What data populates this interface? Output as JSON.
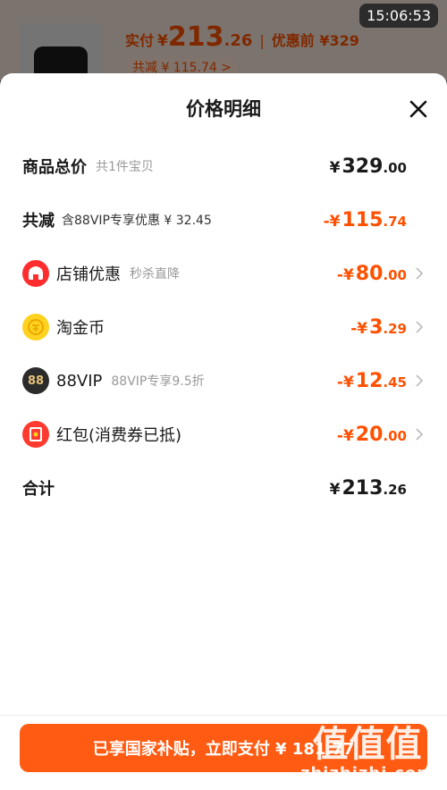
{
  "status": {
    "time": "15:06:53"
  },
  "background": {
    "pay_label": "实付",
    "pay_yen": "¥",
    "pay_int": "213",
    "pay_dec": ".26",
    "separator": "|",
    "orig_label": "优惠前 ¥329",
    "saved": "共减 ¥ 115.74 >"
  },
  "sheet": {
    "title": "价格明细",
    "rows": [
      {
        "label": "商品总价",
        "sub": "共1件宝贝",
        "yen": "¥",
        "int": "329",
        "dec": ".00"
      },
      {
        "label": "共减",
        "sub": "含88VIP专享优惠 ¥ 32.45",
        "yen": "-¥",
        "int": "115",
        "dec": ".74"
      },
      {
        "label": "店铺优惠",
        "sub": "秒杀直降",
        "yen": "-¥",
        "int": "80",
        "dec": ".00",
        "icon": "store-coupon-icon"
      },
      {
        "label": "淘金币",
        "yen": "-¥",
        "int": "3",
        "dec": ".29",
        "icon": "gold-coin-icon"
      },
      {
        "label": "88VIP",
        "sub": "88VIP专享9.5折",
        "icon_text": "88",
        "yen": "-¥",
        "int": "12",
        "dec": ".45",
        "icon": "88vip-icon"
      },
      {
        "label": "红包(消费券已抵)",
        "yen": "-¥",
        "int": "20",
        "dec": ".00",
        "icon": "red-packet-icon"
      },
      {
        "label": "合计",
        "yen": "¥",
        "int": "213",
        "dec": ".26"
      }
    ]
  },
  "footer": {
    "pay_button": "已享国家补贴，立即支付 ¥ 181.77"
  },
  "watermark": {
    "big": "值值值",
    "small": "zhizhizhi.com"
  },
  "colors": {
    "accent": "#ff5000",
    "button": "#ff5b12"
  }
}
